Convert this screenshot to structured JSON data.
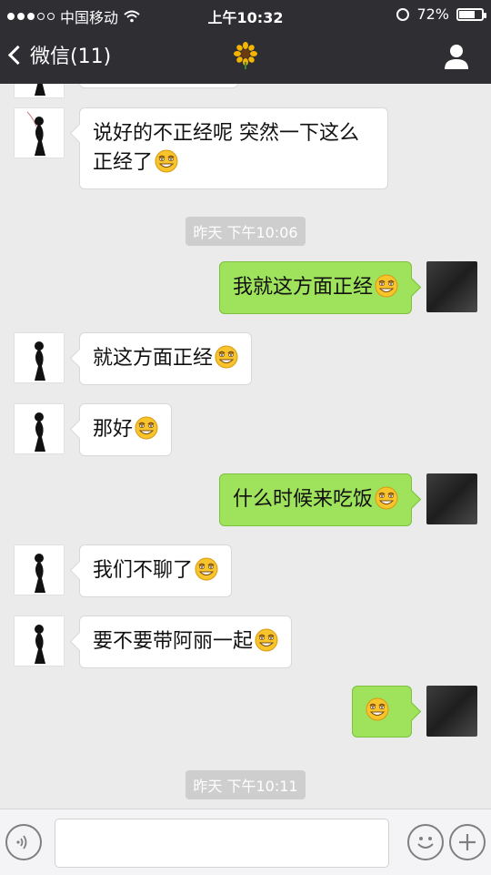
{
  "status_bar": {
    "carrier": "中国移动",
    "time": "上午10:32",
    "battery": "72%",
    "battery_level": 0.72
  },
  "nav": {
    "back_label": "微信(11)"
  },
  "timestamps": {
    "t1": "昨天 下午10:06",
    "t2": "昨天 下午10:11"
  },
  "messages": {
    "m1": "说好的不正经呢 突然一下这么",
    "m1b": "正经了",
    "m2": "我就这方面正经",
    "m3": "就这方面正经",
    "m4": "那好",
    "m5": "什么时候来吃饭",
    "m6": "我们不聊了",
    "m7": "要不要带阿丽一起"
  },
  "icons": {
    "back": "chevron-left-icon",
    "title": "sunflower-icon",
    "profile": "person-icon",
    "voice": "voice-icon",
    "emoji": "smiley-icon",
    "more": "plus-icon"
  },
  "colors": {
    "sent_bubble": "#9fe25b",
    "received_bubble": "#ffffff",
    "nav_bg": "#2e2e33",
    "chat_bg": "#ebebeb"
  }
}
